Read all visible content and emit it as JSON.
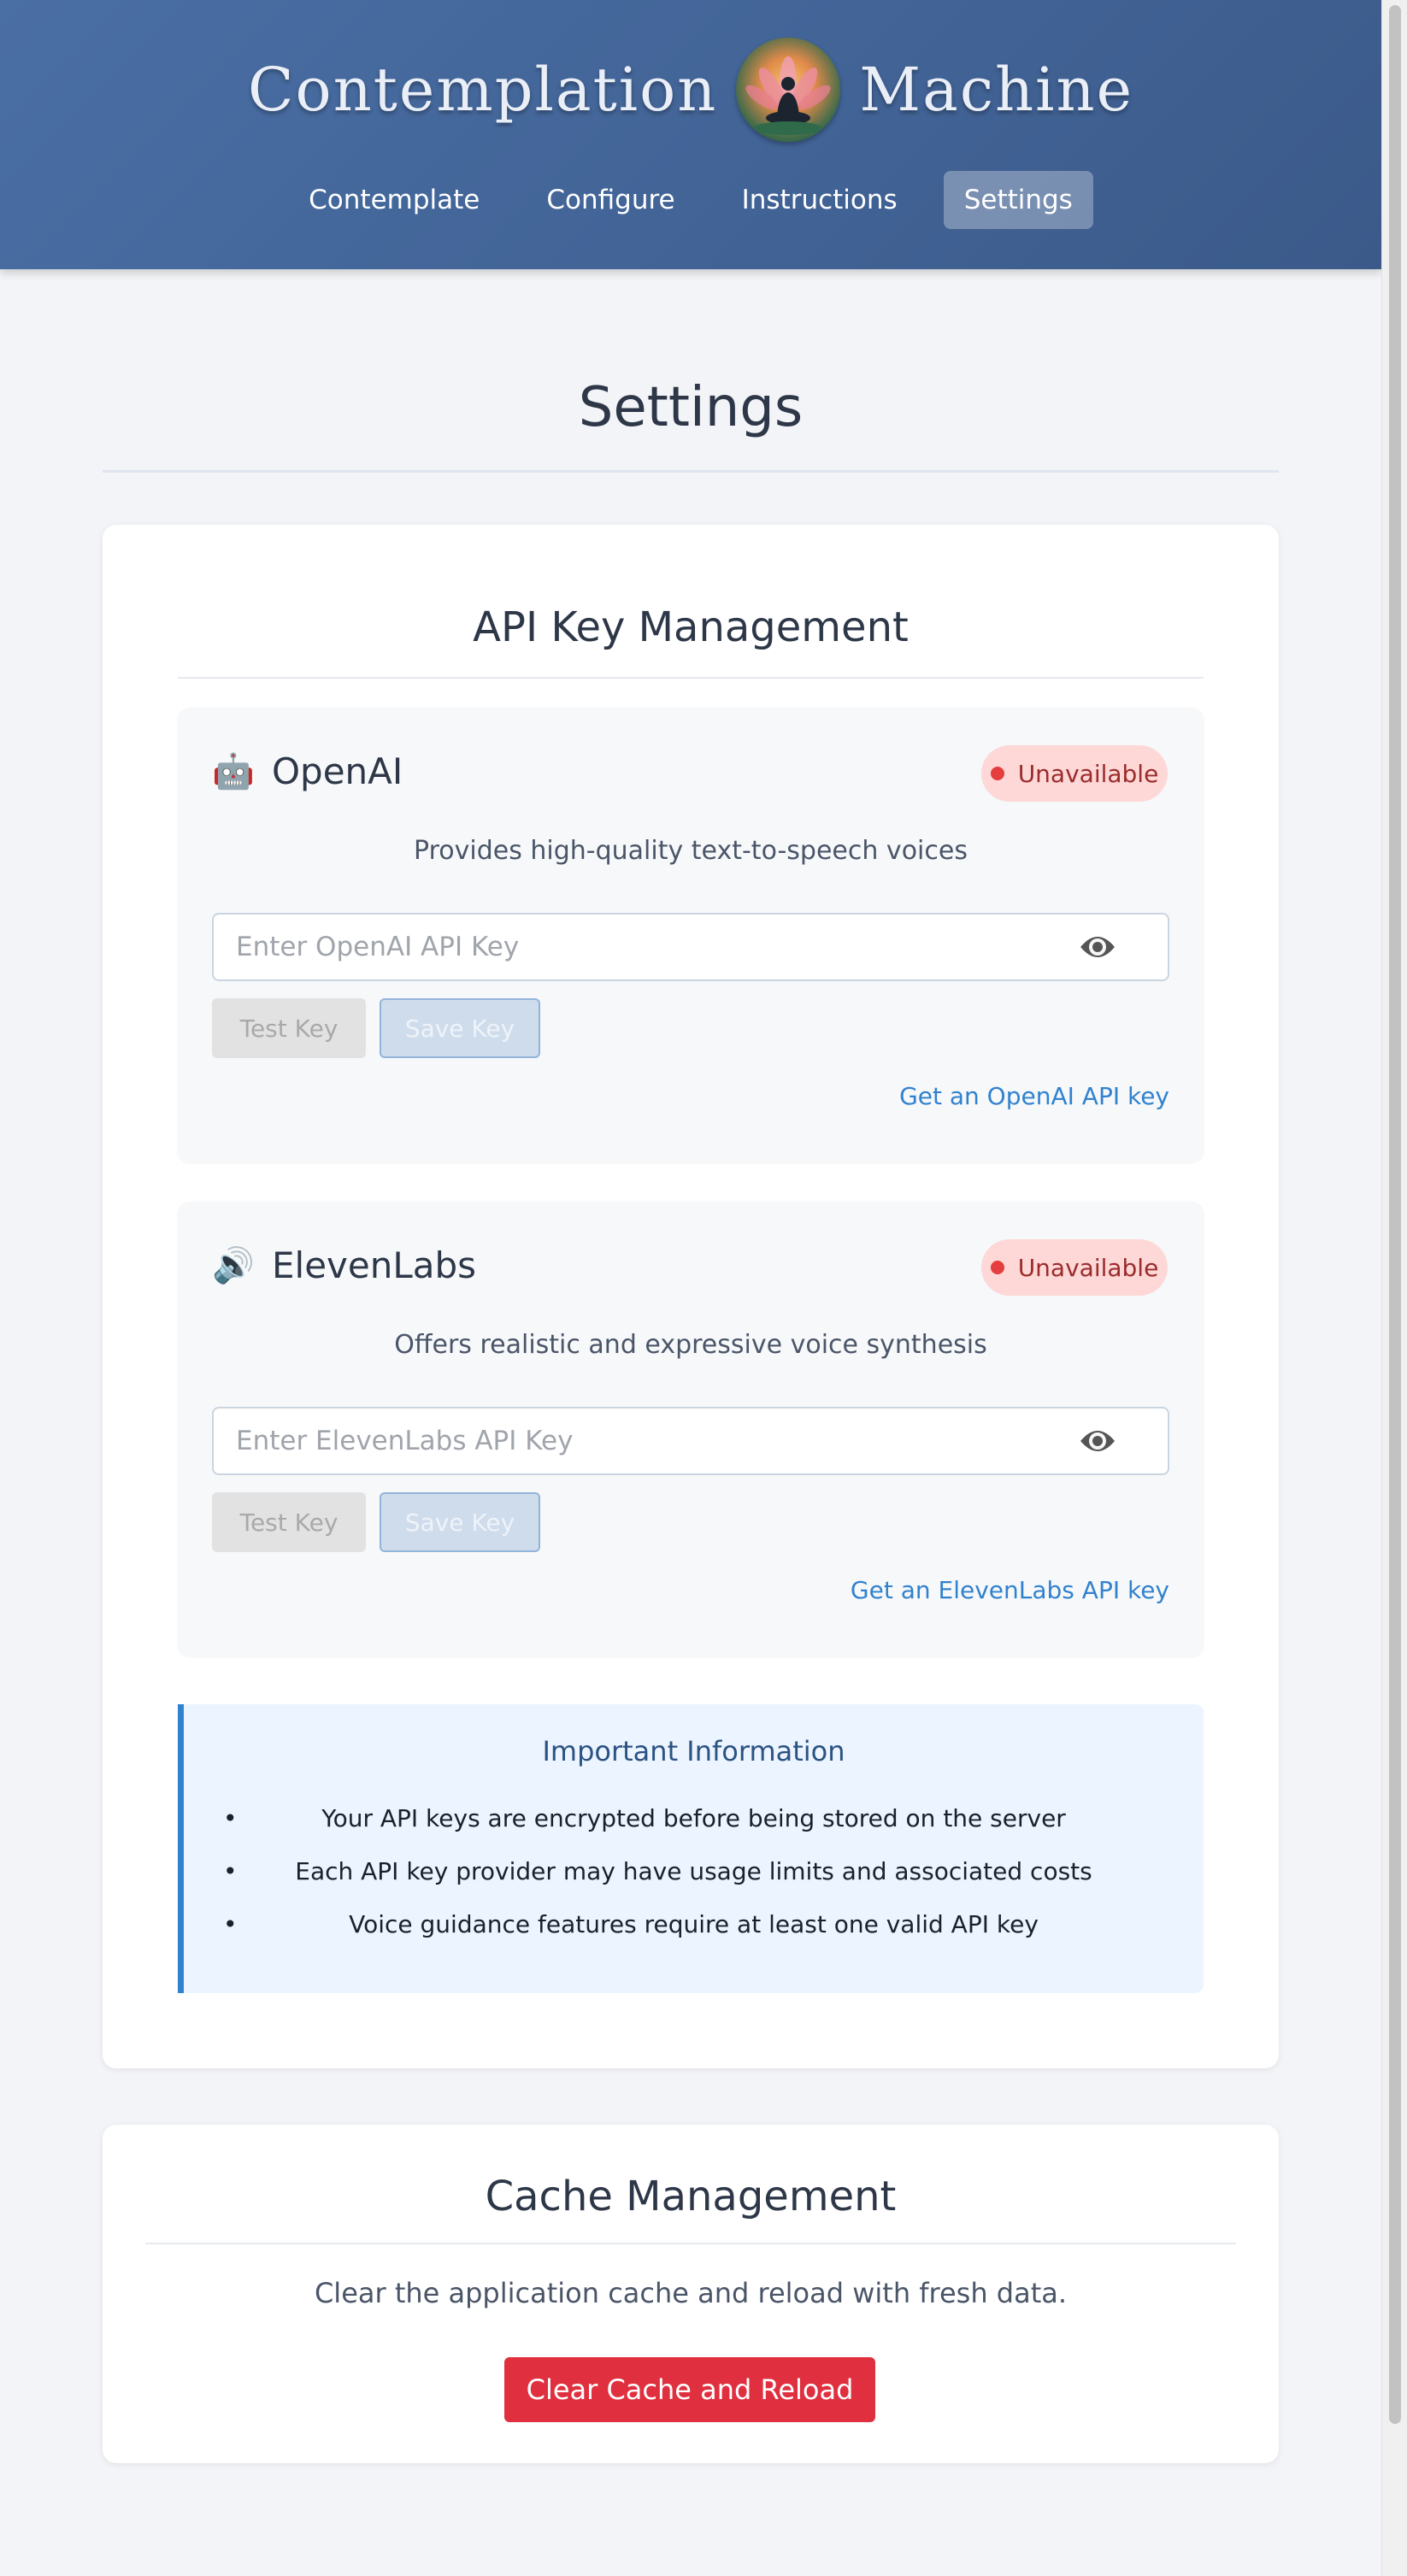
{
  "header": {
    "brand_left": "Contemplation",
    "brand_right": "Machine",
    "nav": [
      {
        "label": "Contemplate"
      },
      {
        "label": "Configure"
      },
      {
        "label": "Instructions"
      },
      {
        "label": "Settings",
        "active": true
      }
    ]
  },
  "page": {
    "title": "Settings"
  },
  "api_section": {
    "title": "API Key Management",
    "providers": [
      {
        "icon": "robot-icon",
        "name": "OpenAI",
        "status": "Unavailable",
        "description": "Provides high-quality text-to-speech voices",
        "placeholder": "Enter OpenAI API Key",
        "value": "",
        "test_label": "Test Key",
        "save_label": "Save Key",
        "link_label": "Get an OpenAI API key"
      },
      {
        "icon": "speaker-icon",
        "name": "ElevenLabs",
        "status": "Unavailable",
        "description": "Offers realistic and expressive voice synthesis",
        "placeholder": "Enter ElevenLabs API Key",
        "value": "",
        "test_label": "Test Key",
        "save_label": "Save Key",
        "link_label": "Get an ElevenLabs API key"
      }
    ],
    "info": {
      "title": "Important Information",
      "items": [
        "Your API keys are encrypted before being stored on the server",
        "Each API key provider may have usage limits and associated costs",
        "Voice guidance features require at least one valid API key"
      ]
    }
  },
  "cache_section": {
    "title": "Cache Management",
    "description": "Clear the application cache and reload with fresh data.",
    "button_label": "Clear Cache and Reload"
  },
  "colors": {
    "header": "#4a6fa5",
    "status_bg": "#fed7d7",
    "status_text": "#9b2c2c",
    "link": "#3182ce",
    "danger": "#e0303f",
    "info_accent": "#3182ce"
  }
}
